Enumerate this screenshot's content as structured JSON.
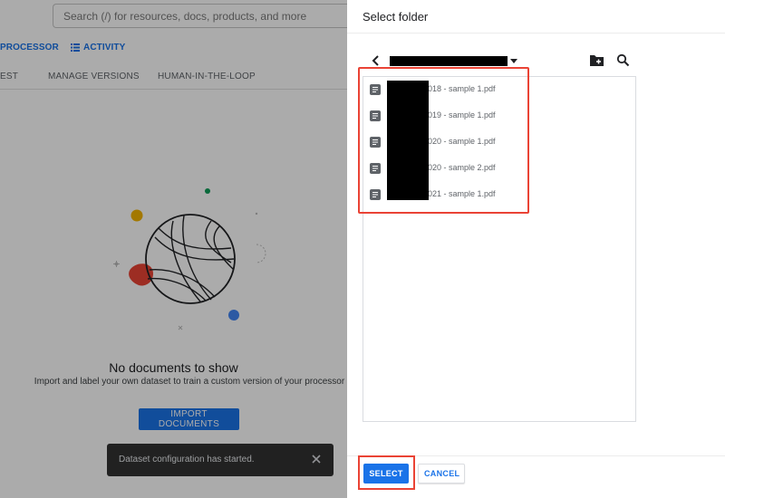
{
  "background_app": {
    "search": {
      "placeholder": "Search (/) for resources, docs, products, and more"
    },
    "nav": {
      "processor_label": "PROCESSOR",
      "activity_label": "ACTIVITY"
    },
    "tabs": [
      "EST",
      "MANAGE VERSIONS",
      "HUMAN-IN-THE-LOOP"
    ],
    "empty_state": {
      "title": "No documents to show",
      "subtitle": "Import and label your own dataset to train a custom version of your processor",
      "import_button": "IMPORT DOCUMENTS"
    },
    "toast": {
      "message": "Dataset configuration has started."
    }
  },
  "dialog": {
    "title": "Select folder",
    "files": [
      {
        "name": "2018 - sample 1.pdf"
      },
      {
        "name": "2019 - sample 1.pdf"
      },
      {
        "name": "2020 - sample 1.pdf"
      },
      {
        "name": "2020 - sample 2.pdf"
      },
      {
        "name": "2021 - sample 1.pdf"
      }
    ],
    "select_button": "SELECT",
    "cancel_button": "CANCEL"
  },
  "colors": {
    "accent": "#1a73e8",
    "highlight": "#ea4335",
    "toast_bg": "#323232"
  },
  "icons": {
    "back": "chevron-left-icon",
    "path_dropdown": "caret-down-icon",
    "new_folder": "create-new-folder-icon",
    "search": "search-icon",
    "file": "document-icon",
    "toast_close": "close-icon",
    "activity": "list-icon"
  }
}
